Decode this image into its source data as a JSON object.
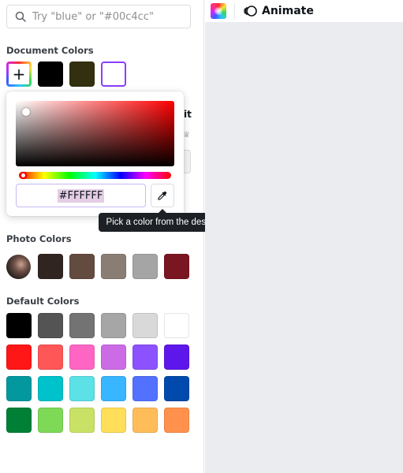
{
  "search": {
    "placeholder": "Try \"blue\" or \"#00c4cc\"",
    "icon": "search-icon"
  },
  "topbar": {
    "color_icon": "rainbow-color-icon",
    "animate_icon": "animate-icon",
    "animate_label": "Animate"
  },
  "document_colors": {
    "title": "Document Colors",
    "add_icon": "plus-icon",
    "swatches": [
      "#000000",
      "#33300f",
      "#ffffff"
    ]
  },
  "picker": {
    "hex_value": "#FFFFFF",
    "eyedropper_icon": "eyedropper-icon",
    "tooltip": "Pick a color from the design"
  },
  "photo_colors": {
    "title": "Photo Colors",
    "swatches": [
      "#302521",
      "#644b3f",
      "#8a7e74",
      "#a5a5a5",
      "#7a1621"
    ]
  },
  "default_colors": {
    "title": "Default Colors",
    "rows": [
      [
        "#000000",
        "#545454",
        "#737373",
        "#a6a6a6",
        "#d9d9d9",
        "#ffffff"
      ],
      [
        "#ff1616",
        "#ff5757",
        "#ff66c4",
        "#cb6ce6",
        "#8c52ff",
        "#5e17eb"
      ],
      [
        "#03989e",
        "#00c2cb",
        "#5ce1e6",
        "#38b6ff",
        "#5271ff",
        "#004aad"
      ],
      [
        "#008037",
        "#7ed957",
        "#c9e265",
        "#ffde59",
        "#ffbd59",
        "#ff914d"
      ]
    ]
  },
  "hidden_peek": {
    "label_fragment": "it"
  }
}
